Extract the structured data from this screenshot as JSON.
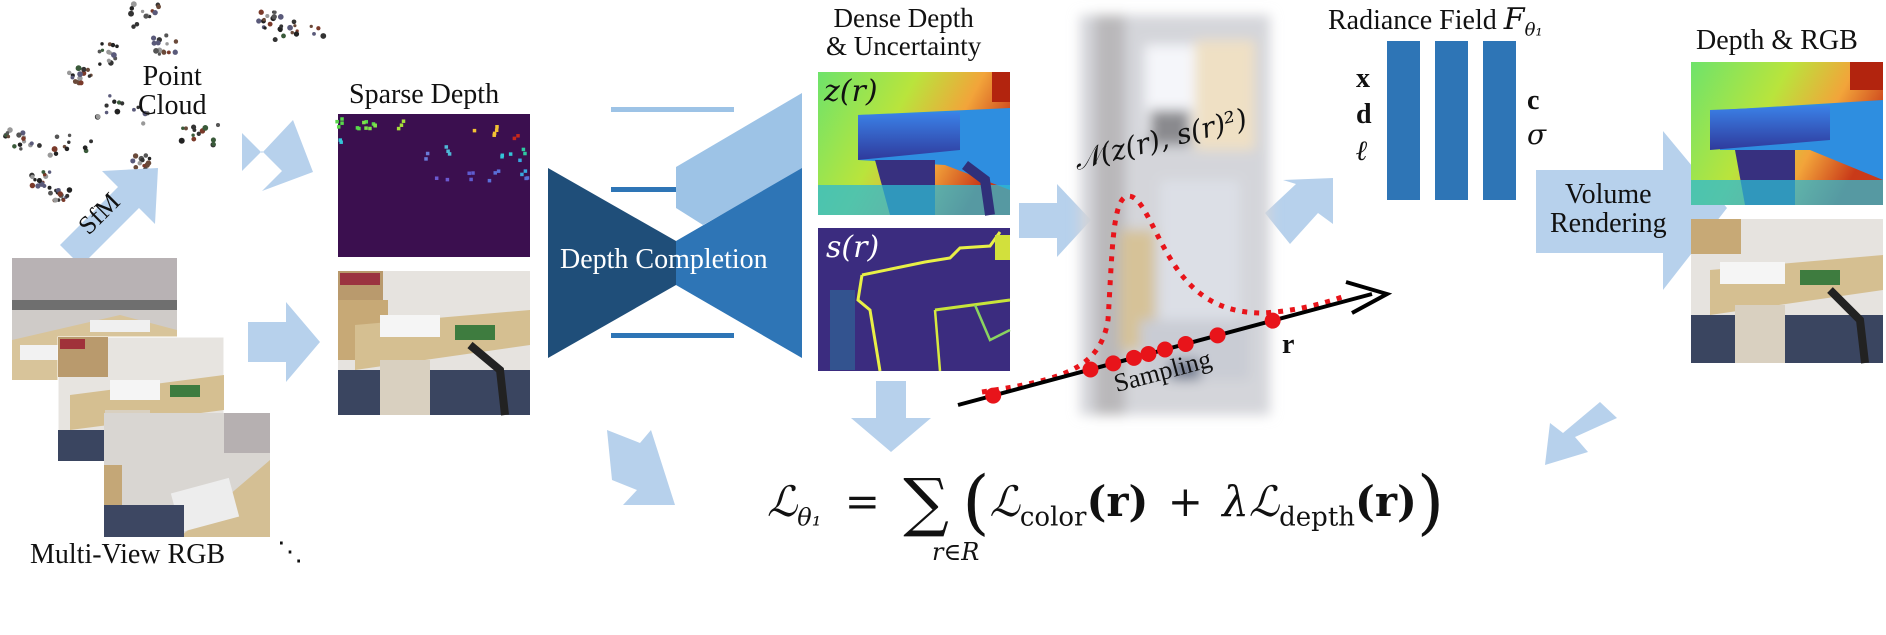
{
  "figure": {
    "labels": {
      "point_cloud": [
        "Point",
        "Cloud"
      ],
      "sfm": "SfM",
      "multi_view_rgb": "Multi-View RGB",
      "ellipsis": "⋱",
      "sparse_depth": "Sparse Depth",
      "depth_completion": "Depth Completion",
      "dense_depth": [
        "Dense Depth",
        "& Uncertainty"
      ],
      "z_r": "z(r)",
      "s_r": "s(r)",
      "normal_dist": "𝒩(z(r), s(r)²)",
      "sampling": "Sampling",
      "ray": "r",
      "radiance_field": "Radiance Field",
      "radiance_symbol": "F",
      "radiance_sub": "θ₁",
      "inputs": [
        "x",
        "d",
        "ℓ"
      ],
      "outputs": [
        "c",
        "σ"
      ],
      "volume_rendering": [
        "Volume",
        "Rendering"
      ],
      "depth_rgb": "Depth & RGB"
    },
    "loss": {
      "lhs": "ℒ",
      "lhs_sub": "θ₁",
      "equals": "=",
      "sum": "∑",
      "sum_sub": "r∈R",
      "term1": "ℒ",
      "term1_sub": "color",
      "arg": "(r)",
      "plus": "+",
      "lambda": "λ",
      "term2": "ℒ",
      "term2_sub": "depth"
    },
    "colors": {
      "arrow": "#b7d1ec",
      "encoder": "#1f4e79",
      "decoder": "#2e75b6",
      "skip_light": "#9dc3e6",
      "mlp": "#2e75b6",
      "sample_red": "#e8141a",
      "viridis_bg": "#3b0f4f"
    }
  }
}
